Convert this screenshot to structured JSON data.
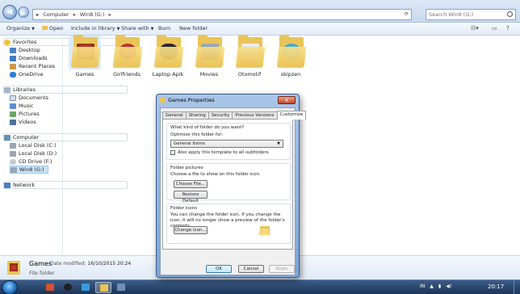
{
  "addressbar": {
    "crumbs": [
      "Computer",
      "Win8 (G:)"
    ],
    "separator": "▸",
    "search_placeholder": "Search Win8 (G:)"
  },
  "toolbar": {
    "organize": "Organize",
    "open": "Open",
    "include": "Include in library",
    "share": "Share with",
    "burn": "Burn",
    "new_folder": "New folder"
  },
  "sidebar": {
    "favorites": "Favorites",
    "desktop": "Desktop",
    "downloads": "Downloads",
    "recent": "Recent Places",
    "onedrive": "OneDrive",
    "libraries": "Libraries",
    "documents": "Documents",
    "music": "Music",
    "pictures": "Pictures",
    "videos": "Videos",
    "computer": "Computer",
    "disk_c": "Local Disk (C:)",
    "disk_d": "Local Disk (D:)",
    "cd_drive": "CD Drive (F:)",
    "win8": "Win8 (G:)",
    "network": "Network"
  },
  "folders": [
    {
      "label": "Games",
      "color": "#c0392b"
    },
    {
      "label": "Girlfriends",
      "color": "#d63b3b"
    },
    {
      "label": "Laptop Apik",
      "color": "#2b2b2b"
    },
    {
      "label": "Movies",
      "color": "#6b7a86"
    },
    {
      "label": "Otomotif",
      "color": "#d8d8d8"
    },
    {
      "label": "skipzen",
      "color": "#2aa7c9"
    }
  ],
  "details": {
    "name": "Games",
    "type": "File folder",
    "modified_label": "Date modified:",
    "modified_value": "16/10/2015 20:24"
  },
  "dialog": {
    "title": "Games Properties",
    "close": "x",
    "tabs": [
      "General",
      "Sharing",
      "Security",
      "Previous Versions",
      "Customize"
    ],
    "active_tab": "Customize",
    "q_type": "What kind of folder do you want?",
    "optimize_label": "Optimize this folder for:",
    "optimize_value": "General Items",
    "apply_template": "Also apply this template to all subfolders",
    "pictures_title": "Folder pictures",
    "pictures_text": "Choose a file to show on this folder icon.",
    "choose_file": "Choose File...",
    "restore_default": "Restore Default",
    "icons_title": "Folder icons",
    "icons_text": "You can change the folder icon. If you change the icon, it will no longer show a preview of the folder's contents.",
    "change_icon": "Change Icon...",
    "ok": "OK",
    "cancel": "Cancel",
    "apply": "Apply"
  },
  "taskbar": {
    "lang": "IN",
    "clock": "20:17"
  },
  "colors": {
    "accent": "#3c7fb1",
    "folder": "#e8c45a"
  }
}
